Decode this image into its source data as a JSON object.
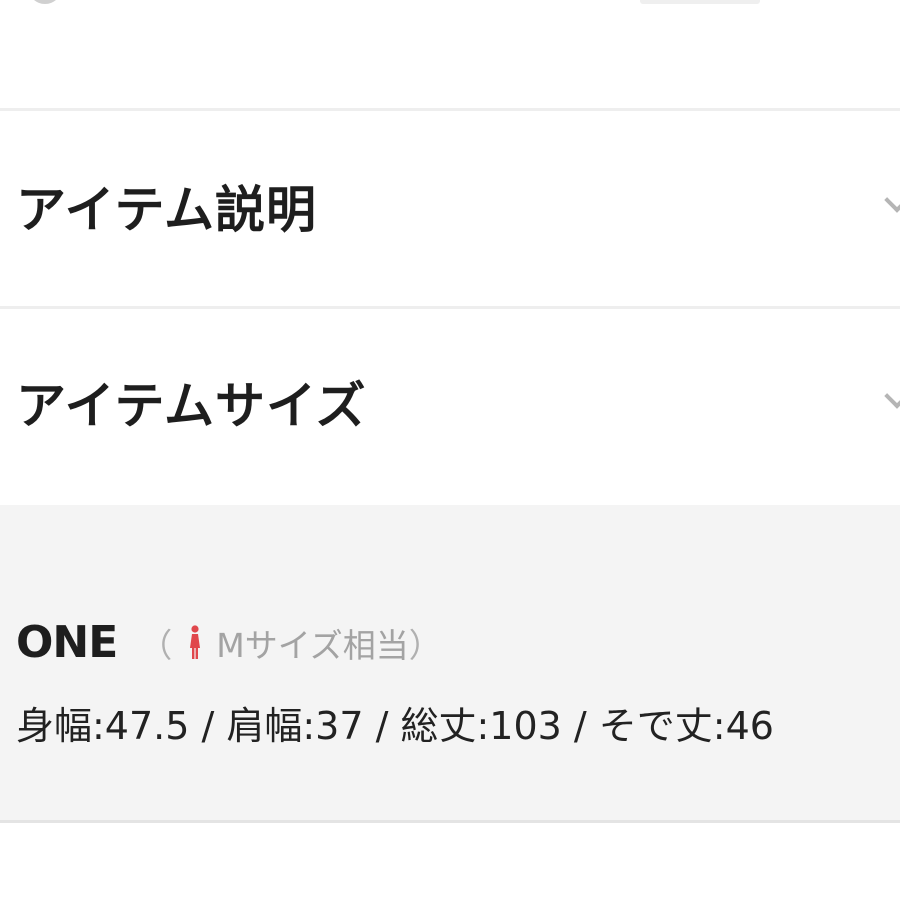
{
  "sections": {
    "description": {
      "title": "アイテム説明"
    },
    "size": {
      "title": "アイテムサイズ"
    }
  },
  "size_info": {
    "size_name": "ONE",
    "paren_open": "（",
    "equivalent": "Mサイズ相当",
    "paren_close": "）",
    "measurements": "身幅:47.5 / 肩幅:37 / 総丈:103 / そで丈:46"
  },
  "colors": {
    "female_icon": "#e0474c",
    "panel_bg": "#f4f4f4"
  },
  "icons": {
    "section_chevron": "chevron-down-icon",
    "gender": "female-person-icon"
  }
}
